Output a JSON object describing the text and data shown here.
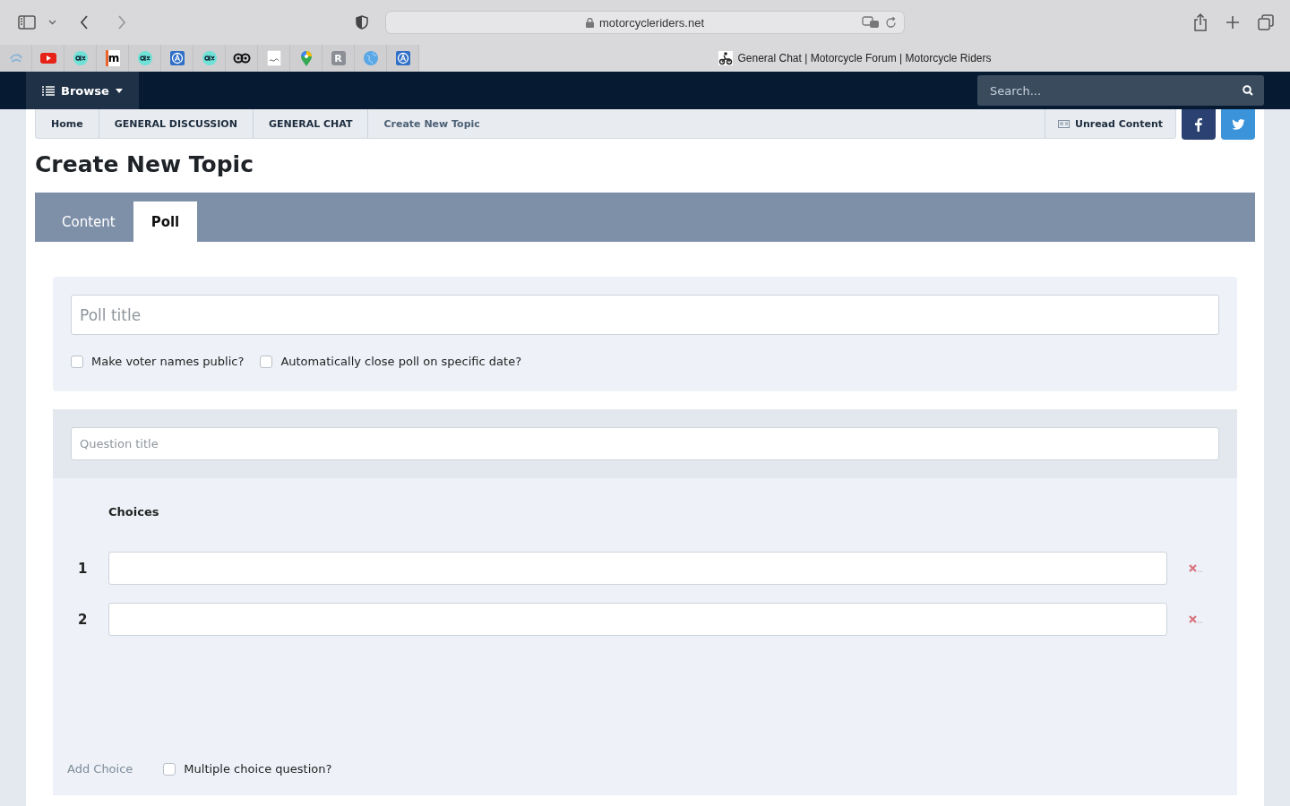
{
  "browser": {
    "url": "motorcycleriders.net",
    "tab_title": "General Chat | Motorcycle Forum | Motorcycle Riders",
    "bookmarks": [
      {
        "kind": "swirl"
      },
      {
        "kind": "play"
      },
      {
        "kind": "olx"
      },
      {
        "kind": "letter",
        "label": "m"
      },
      {
        "kind": "olx"
      },
      {
        "kind": "a"
      },
      {
        "kind": "olx"
      },
      {
        "kind": "owl"
      },
      {
        "kind": "doc"
      },
      {
        "kind": "pin"
      },
      {
        "kind": "badge",
        "label": "R"
      },
      {
        "kind": "globe"
      },
      {
        "kind": "a"
      }
    ]
  },
  "nav": {
    "browse": "Browse",
    "search": {
      "placeholder": "Search..."
    }
  },
  "breadcrumb": [
    {
      "label": "Home",
      "current": false
    },
    {
      "label": "GENERAL DISCUSSION",
      "current": false
    },
    {
      "label": "GENERAL CHAT",
      "current": false
    },
    {
      "label": "Create New Topic",
      "current": true
    }
  ],
  "unread": "Unread Content",
  "page_title": "Create New Topic",
  "tabs": [
    {
      "label": "Content",
      "selected": false
    },
    {
      "label": "Poll",
      "selected": true
    }
  ],
  "poll": {
    "title": {
      "placeholder": "Poll title"
    },
    "options": [
      {
        "label": "Make voter names public?",
        "checked": false
      },
      {
        "label": "Automatically close poll on specific date?",
        "checked": false
      }
    ]
  },
  "question": {
    "placeholder": "Question title",
    "choices_heading": "Choices",
    "choices": [
      {
        "number": "1"
      },
      {
        "number": "2"
      }
    ],
    "add_choice": "Add Choice",
    "multiple": {
      "label": "Multiple choice question?",
      "checked": false
    }
  }
}
